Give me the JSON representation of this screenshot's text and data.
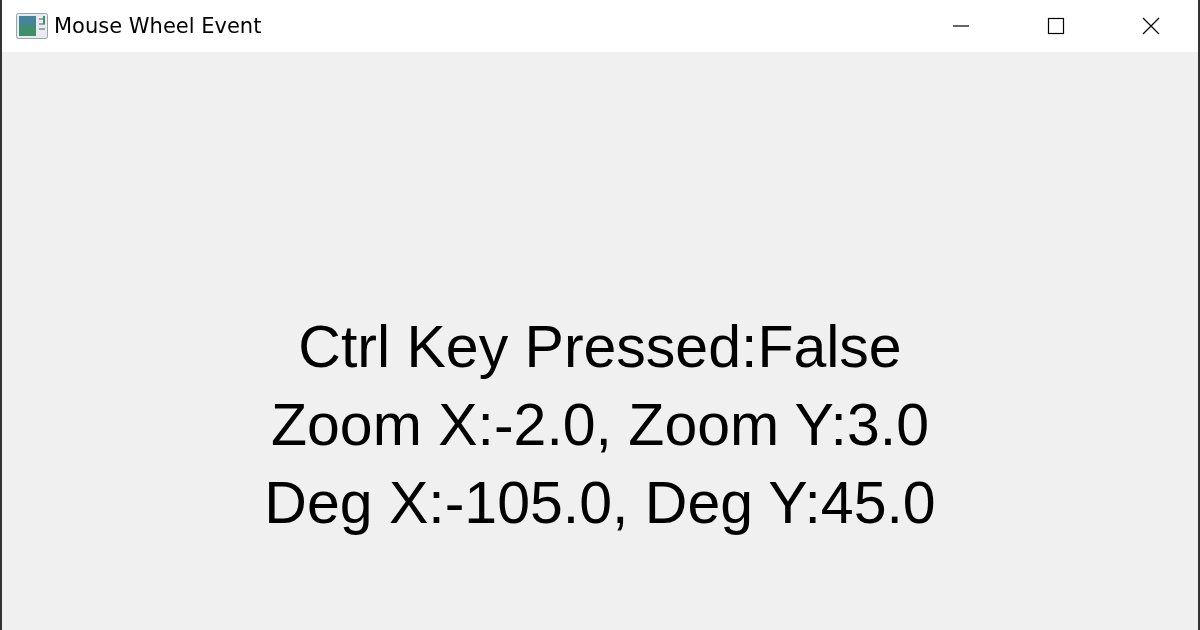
{
  "window": {
    "title": "Mouse Wheel Event"
  },
  "lines": [
    "Ctrl Key Pressed:False",
    "Zoom X:-2.0, Zoom Y:3.0",
    "Deg X:-105.0, Deg Y:45.0"
  ]
}
